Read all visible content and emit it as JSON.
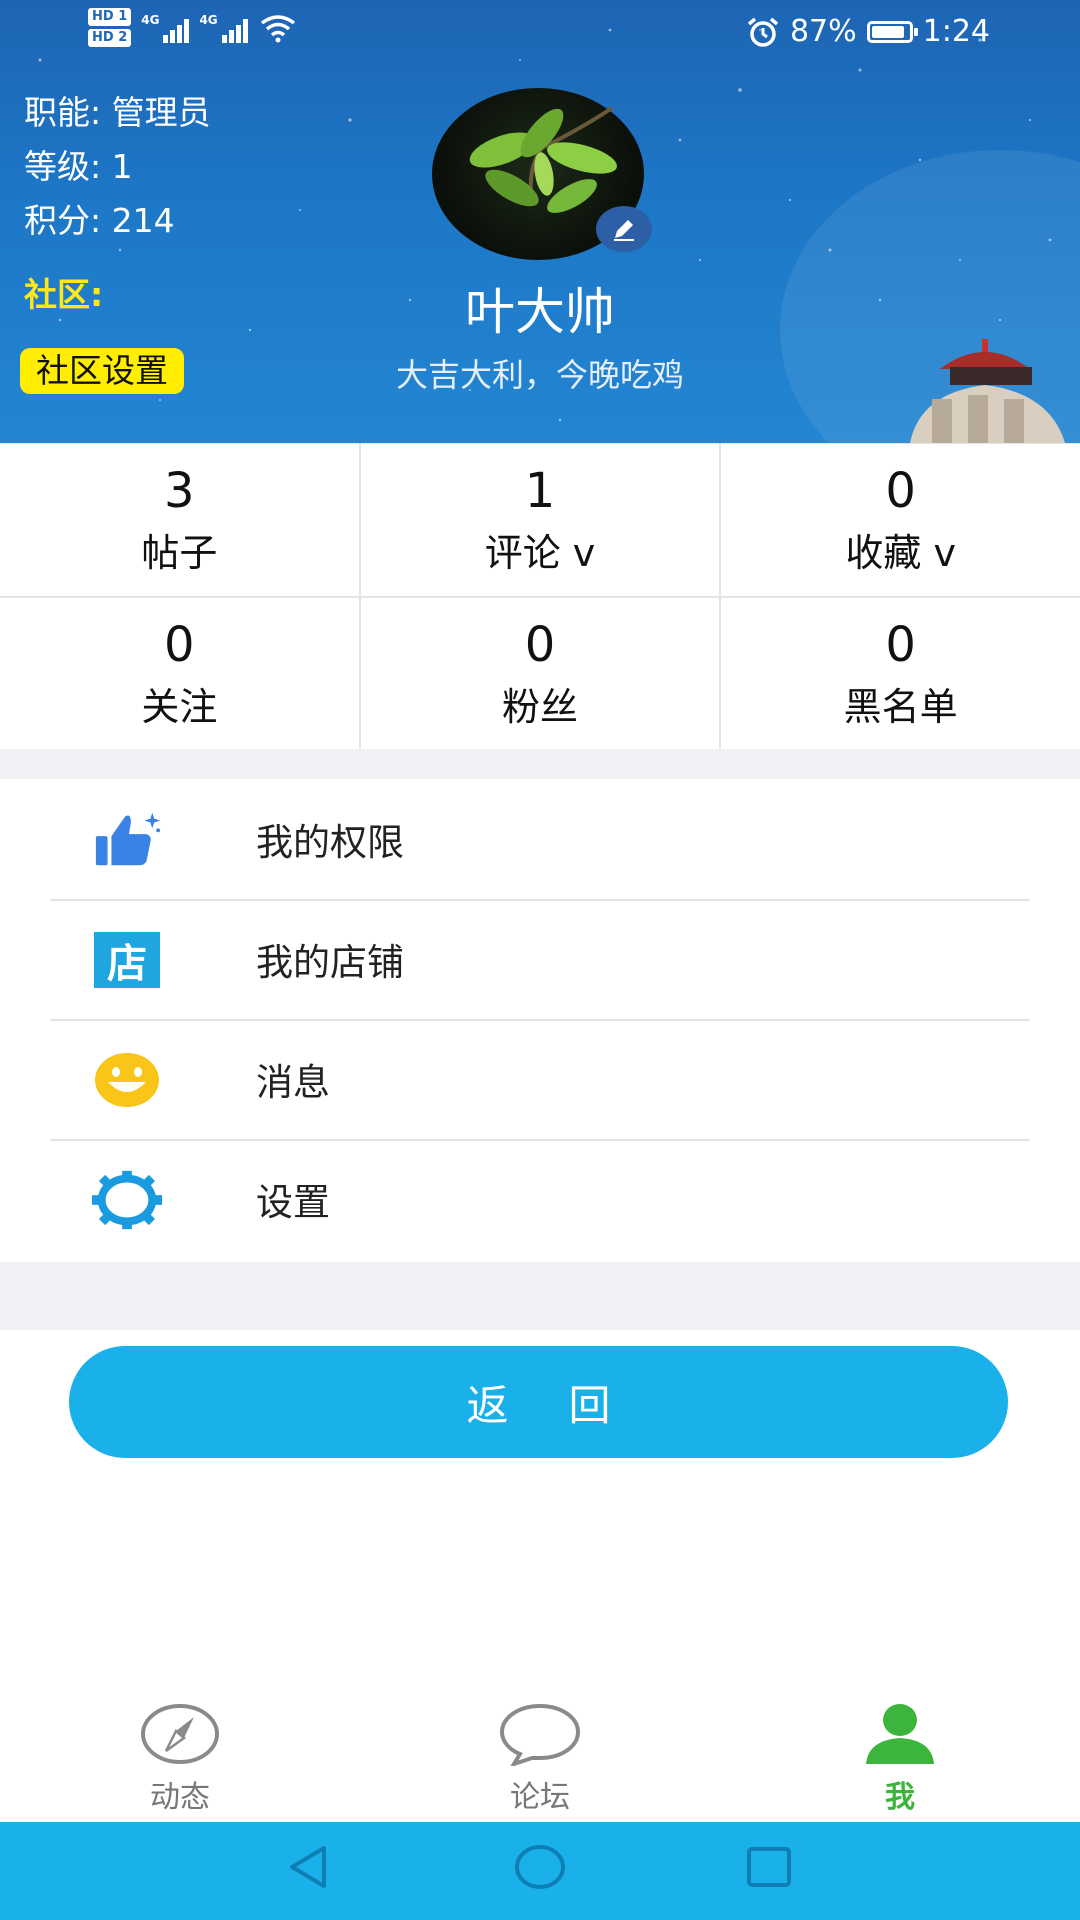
{
  "status_bar": {
    "sim1": "HD 1",
    "sim2": "HD 2",
    "net1": "4G",
    "net2": "4G",
    "battery": "87%",
    "time": "1:24"
  },
  "profile": {
    "role_label": "职能:",
    "role_value": "管理员",
    "level_label": "等级:",
    "level_value": "1",
    "points_label": "积分:",
    "points_value": "214",
    "community_label": "社区:",
    "community_settings": "社区设置",
    "username": "叶大帅",
    "signature": "大吉大利，今晚吃鸡"
  },
  "stats": [
    {
      "value": "3",
      "label": "帖子"
    },
    {
      "value": "1",
      "label": "评论 v"
    },
    {
      "value": "0",
      "label": "收藏 v"
    },
    {
      "value": "0",
      "label": "关注"
    },
    {
      "value": "0",
      "label": "粉丝"
    },
    {
      "value": "0",
      "label": "黑名单"
    }
  ],
  "menu": [
    {
      "label": "我的权限",
      "icon": "thumbs-up-icon"
    },
    {
      "label": "我的店铺",
      "icon": "store-icon",
      "icon_text": "店"
    },
    {
      "label": "消息",
      "icon": "smiley-icon"
    },
    {
      "label": "设置",
      "icon": "gear-icon"
    }
  ],
  "back_button": "返回",
  "bottom_nav": [
    {
      "label": "动态",
      "icon": "compass-icon"
    },
    {
      "label": "论坛",
      "icon": "chat-bubble-icon"
    },
    {
      "label": "我",
      "icon": "person-icon",
      "active": true
    }
  ],
  "colors": {
    "accent": "#1ab1ea",
    "active_tab": "#3bb53b",
    "community_yellow": "#ffee00"
  }
}
